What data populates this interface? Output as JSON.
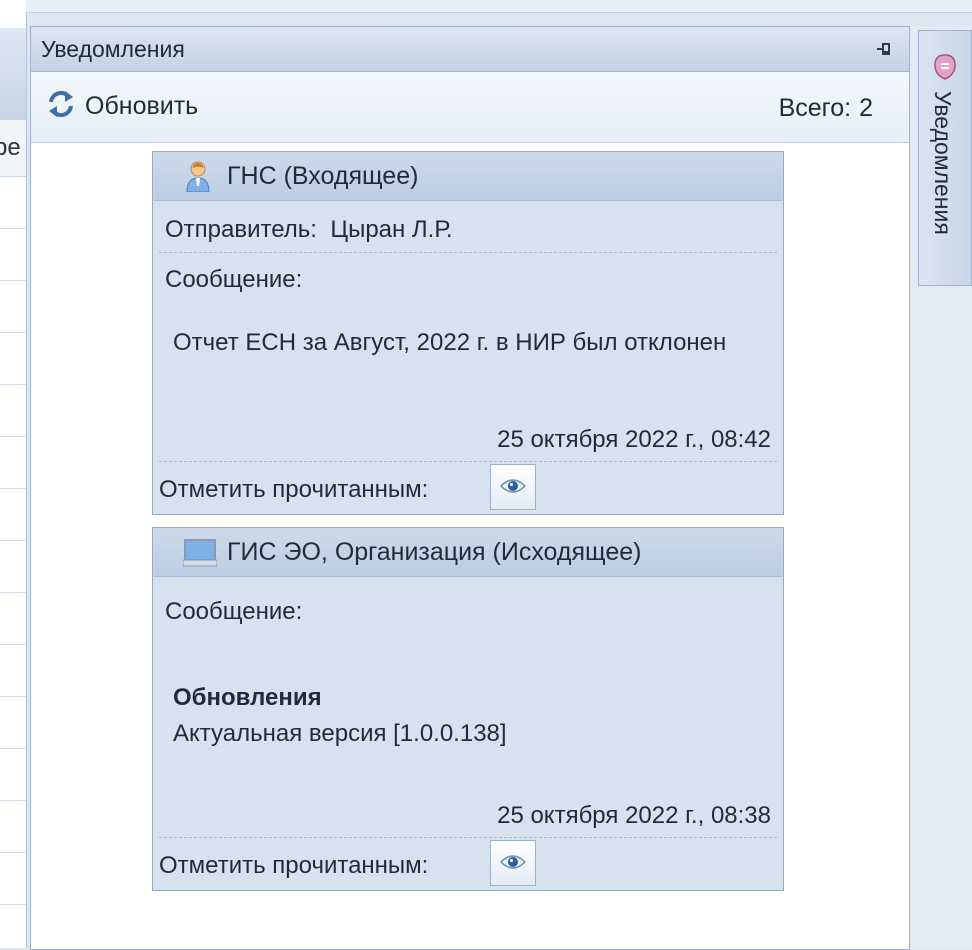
{
  "left_panel": {
    "column_fragment": "ре"
  },
  "panel": {
    "title": "Уведомления",
    "refresh_label": "Обновить",
    "total_label": "Всего:",
    "total_value": "2"
  },
  "notifications": [
    {
      "header": "ГНС (Входящее)",
      "sender_label": "Отправитель:",
      "sender_value": "Цыран Л.Р.",
      "message_label": "Сообщение:",
      "message_text": "Отчет ЕСН за Август, 2022 г. в НИР был отклонен",
      "date": "25 октября 2022 г., 08:42",
      "mark_read_label": "Отметить прочитанным:"
    },
    {
      "header": "ГИС ЭО, Организация (Исходящее)",
      "message_label": "Сообщение:",
      "message_title": "Обновления",
      "message_text": "Актуальная версия [1.0.0.138]",
      "date": "25 октября 2022 г., 08:38",
      "mark_read_label": "Отметить прочитанным:"
    }
  ],
  "side_tab": {
    "label": "Уведомления"
  },
  "icons": {
    "refresh": "refresh-icon",
    "pin": "pin-icon",
    "person": "person-icon",
    "computer": "computer-icon",
    "eye": "eye-icon",
    "notification": "notification-icon"
  }
}
